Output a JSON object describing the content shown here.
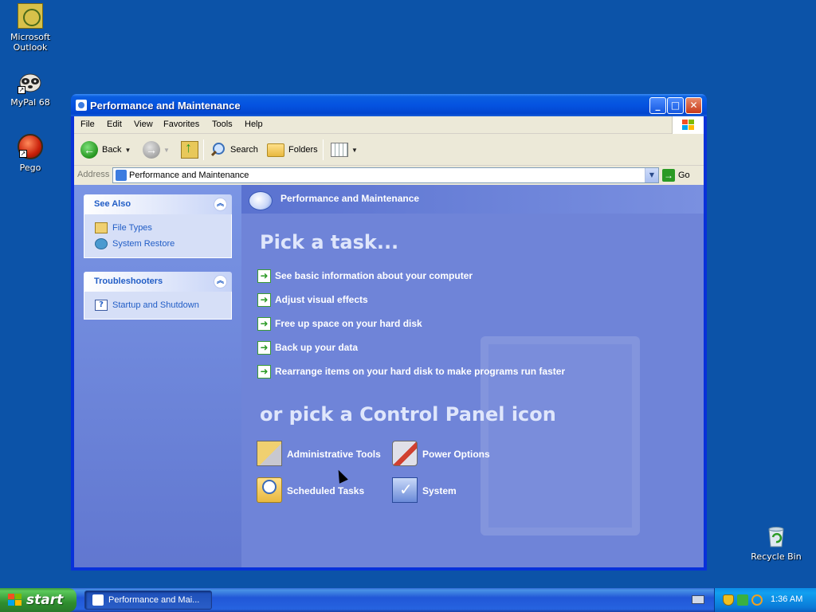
{
  "desktop": {
    "icons": [
      {
        "label": "Microsoft Outlook"
      },
      {
        "label": "MyPal 68"
      },
      {
        "label": "Pego"
      },
      {
        "label": "Recycle Bin"
      }
    ]
  },
  "window": {
    "title": "Performance and Maintenance",
    "menu": [
      "File",
      "Edit",
      "View",
      "Favorites",
      "Tools",
      "Help"
    ],
    "toolbar": {
      "back": "Back",
      "search": "Search",
      "folders": "Folders"
    },
    "address": {
      "label": "Address",
      "value": "Performance and Maintenance",
      "go": "Go"
    }
  },
  "taskpane": {
    "see_also": {
      "title": "See Also",
      "links": [
        "File Types",
        "System Restore"
      ]
    },
    "troubleshooters": {
      "title": "Troubleshooters",
      "links": [
        "Startup and Shutdown"
      ]
    }
  },
  "main": {
    "header": "Performance and Maintenance",
    "pick_task": "Pick a task...",
    "tasks": [
      "See basic information about your computer",
      "Adjust visual effects",
      "Free up space on your hard disk",
      "Back up your data",
      "Rearrange items on your hard disk to make programs run faster"
    ],
    "pick_icon": "or pick a Control Panel icon",
    "icons": [
      "Administrative Tools",
      "Power Options",
      "Scheduled Tasks",
      "System"
    ]
  },
  "taskbar": {
    "start": "start",
    "task_button": "Performance and Mai...",
    "clock": "1:36 AM"
  },
  "colors": {
    "desktop": "#0c53a8",
    "titlebar": "#0553e0",
    "content": "#6f84d8",
    "link": "#215dc6"
  }
}
